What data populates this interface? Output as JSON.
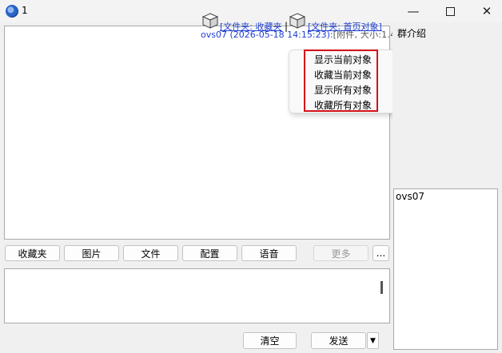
{
  "window": {
    "title": "1"
  },
  "message": {
    "sender": "ovs07 (2026-05-18 14:15:23):",
    "attachment_info": "[附件, 大小:1.4 M]",
    "folder_link": "[文件夹: 收藏夹",
    "folder_link_2": "[文件夹: 首页对象]"
  },
  "context_menu": {
    "items": [
      {
        "label": "显示当前对象"
      },
      {
        "label": "收藏当前对象"
      },
      {
        "label": "显示所有对象"
      },
      {
        "label": "收藏所有对象"
      }
    ],
    "highlight_color": "#d4101a"
  },
  "toolbar": {
    "favorites": "收藏夹",
    "picture": "图片",
    "file": "文件",
    "config": "配置",
    "voice": "语音",
    "more": "更多",
    "ellipsis": "..."
  },
  "actions": {
    "clear": "清空",
    "send": "发送"
  },
  "sidebar": {
    "intro_label": "群介绍",
    "members": [
      "ovs07"
    ]
  },
  "icons": {
    "app": "app-logo-icon",
    "minimize": "minimize-icon",
    "maximize": "maximize-icon",
    "close": "close-icon",
    "attachment": "box-icon",
    "dropdown": "triangle-down-icon"
  }
}
